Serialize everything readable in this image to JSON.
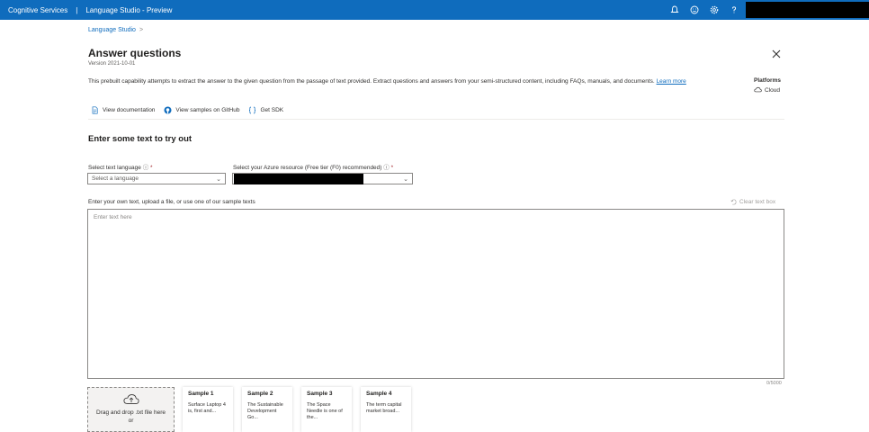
{
  "topbar": {
    "brand": "Cognitive Services",
    "separator": "|",
    "studio": "Language Studio - Preview",
    "icons": [
      "notification-icon",
      "feedback-icon",
      "settings-icon",
      "help-icon"
    ]
  },
  "breadcrumb": {
    "item": "Language Studio",
    "chevron": ">"
  },
  "header": {
    "title": "Answer questions",
    "version": "Version 2021-10-01",
    "description": "This prebuilt capability attempts to extract the answer to the given question from the passage of text provided. Extract questions and answers from your semi-structured content, including FAQs, manuals, and documents.",
    "learn_more": "Learn more"
  },
  "platforms": {
    "label": "Platforms",
    "value": "Cloud"
  },
  "links": {
    "documentation": "View documentation",
    "github": "View samples on GitHub",
    "sdk": "Get SDK"
  },
  "section_title": "Enter some text to try out",
  "language": {
    "label": "Select text language",
    "required": "*",
    "placeholder": "Select a language"
  },
  "resource": {
    "label": "Select your Azure resource (Free tier (F0) recommended)",
    "required": "*"
  },
  "input": {
    "instructions": "Enter your own text, upload a file, or use one of our sample texts",
    "clear_label": "Clear text box",
    "placeholder": "Enter text here",
    "counter": "0/5000"
  },
  "upload": {
    "line1": "Drag and drop .txt file here",
    "line2": "or"
  },
  "samples": [
    {
      "title": "Sample 1",
      "text": "Surface Laptop 4 is, first and..."
    },
    {
      "title": "Sample 2",
      "text": "The Sustainable Development Go..."
    },
    {
      "title": "Sample 3",
      "text": "The Space Needle is one of the..."
    },
    {
      "title": "Sample 4",
      "text": "The term capital market broad..."
    }
  ],
  "colors": {
    "accent": "#0f6cbd",
    "required": "#a4262c"
  }
}
